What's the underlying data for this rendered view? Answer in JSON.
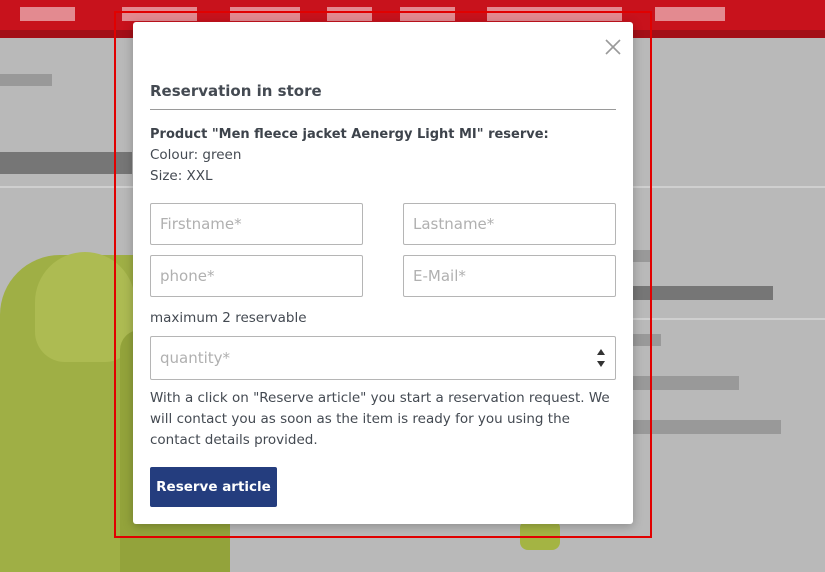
{
  "modal": {
    "title": "Reservation in store",
    "product_line": "Product \"Men fleece jacket Aenergy Light MI\" reserve:",
    "colour_line": "Colour: green",
    "size_line": "Size: XXL",
    "fields": {
      "firstname_placeholder": "Firstname*",
      "lastname_placeholder": "Lastname*",
      "phone_placeholder": "phone*",
      "email_placeholder": "E-Mail*",
      "quantity_placeholder": "quantity*"
    },
    "max_hint": "maximum 2 reservable",
    "info_text": "With a click on \"Reserve article\" you start a reservation request. We will contact you as soon as the item is ready for you using the contact details provided.",
    "reserve_button": "Reserve article"
  },
  "colors": {
    "header_red": "#c8121c",
    "button_blue": "#243d7e",
    "highlight_red": "#e10000"
  },
  "icons": {
    "close": "close-icon",
    "spinner_up": "chevron-up-icon",
    "spinner_down": "chevron-down-icon"
  }
}
